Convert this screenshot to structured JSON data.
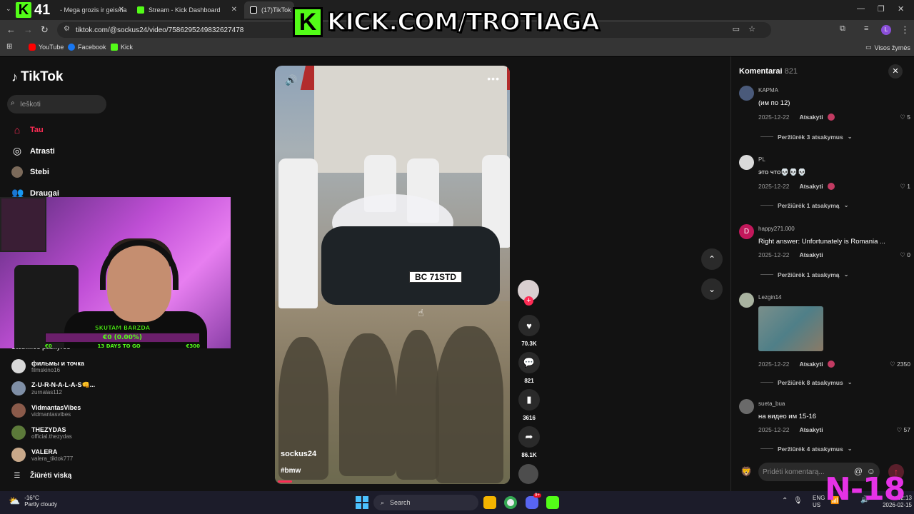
{
  "browser": {
    "tabs": [
      {
        "label": "- Mega grozis ir geisma",
        "favicon_color": "#53fc18"
      },
      {
        "label": "Stream - Kick Dashboard",
        "favicon_color": "#53fc18"
      },
      {
        "label": "(17)TikTok -",
        "favicon_color": "#ffffff"
      }
    ],
    "kick_tab_number": "41",
    "url": "tiktok.com/@sockus24/video/7586295249832627478",
    "bookmarks": [
      {
        "label": "YouTube",
        "icon": "youtube-icon"
      },
      {
        "label": "Facebook",
        "icon": "facebook-icon"
      },
      {
        "label": "Kick",
        "icon": "kick-icon"
      }
    ],
    "all_bookmarks_label": "Visos žymės",
    "profile_initial": "L"
  },
  "overlay": {
    "kick_banner": "KICK.COM/TROTIAGA",
    "sub_goal": {
      "title": "SKUTAM BARZDA",
      "progress_text": "€0 (0.00%)",
      "current": "€0",
      "days_left": "13 DAYS TO GO",
      "target": "€300"
    },
    "age_badge": "N-18"
  },
  "tiktok": {
    "logo": "TikTok",
    "search_placeholder": "Ieškoti",
    "nav": [
      {
        "label": "Tau",
        "icon": "home-icon"
      },
      {
        "label": "Atrasti",
        "icon": "compass-icon"
      },
      {
        "label": "Stebi",
        "icon": "following-icon"
      },
      {
        "label": "Draugai",
        "icon": "friends-icon"
      }
    ],
    "following_header": "Stebimos paskyros",
    "following": [
      {
        "name": "фильмы и точка",
        "handle": "filmskino16",
        "color": "#d8d8d8"
      },
      {
        "name": "Z-U-R-N-A-L-A-S👊...",
        "handle": "zurnalas112",
        "color": "#7f8fa6"
      },
      {
        "name": "VidmantasVibes",
        "handle": "vidmantasvibes",
        "color": "#8a5a4a"
      },
      {
        "name": "THEZYDAS",
        "handle": "official.thezydas",
        "color": "#5c7a3a"
      },
      {
        "name": "VALERA",
        "handle": "valera_tiktok777",
        "color": "#c8a88a"
      }
    ],
    "see_all": "Žiūrėti viską"
  },
  "video": {
    "author": "sockus24",
    "caption": "#bmw",
    "plate": "BC 71STD",
    "playback_fraction": 0.06,
    "actions": [
      {
        "name": "like",
        "icon": "heart-icon",
        "count": "70.3K"
      },
      {
        "name": "comment",
        "icon": "comment-icon",
        "count": "821"
      },
      {
        "name": "save",
        "icon": "bookmark-icon",
        "count": "3616"
      },
      {
        "name": "share",
        "icon": "share-icon",
        "count": "86.1K"
      }
    ]
  },
  "comments_panel": {
    "title": "Komentarai",
    "count": "821",
    "input_placeholder": "Pridėti komentarą...",
    "comments": [
      {
        "user": "ΚΑΡΜΑ",
        "text": "(им по 12)",
        "date": "2025-12-22",
        "reply": "Atsakyti",
        "likes": "5",
        "view": "Peržiūrėk 3 atsakymus",
        "avatar": "#4a5a7a"
      },
      {
        "user": "PL",
        "text": "это что💀💀💀",
        "date": "2025-12-22",
        "reply": "Atsakyti",
        "likes": "1",
        "view": "Peržiūrėk 1 atsakymą",
        "avatar": "#d9d9d9"
      },
      {
        "user": "happy271.000",
        "text": "Right answer: Unfortunately is Romania ...",
        "date": "2025-12-22",
        "reply": "Atsakyti",
        "likes": "0",
        "view": "Peržiūrėk 1 atsakymą",
        "avatar": "#c2185b",
        "initial": "D"
      },
      {
        "user": "Lezgin14",
        "text": "",
        "date": "2025-12-22",
        "reply": "Atsakyti",
        "likes": "2350",
        "view": "Peržiūrėk 8 atsakymus",
        "avatar": "#a9b3a0"
      },
      {
        "user": "sueta_bua",
        "text": "на видео им 15-16",
        "date": "2025-12-22",
        "reply": "Atsakyti",
        "likes": "57",
        "view": "Peržiūrėk 4 atsakymus",
        "avatar": "#6a6a6a"
      }
    ]
  },
  "taskbar": {
    "temperature": "-16°C",
    "weather": "Partly cloudy",
    "search": "Search",
    "lang": "ENG",
    "region": "US",
    "time": "02:13",
    "date": "2026-02-15",
    "discord_badge": "9+"
  }
}
